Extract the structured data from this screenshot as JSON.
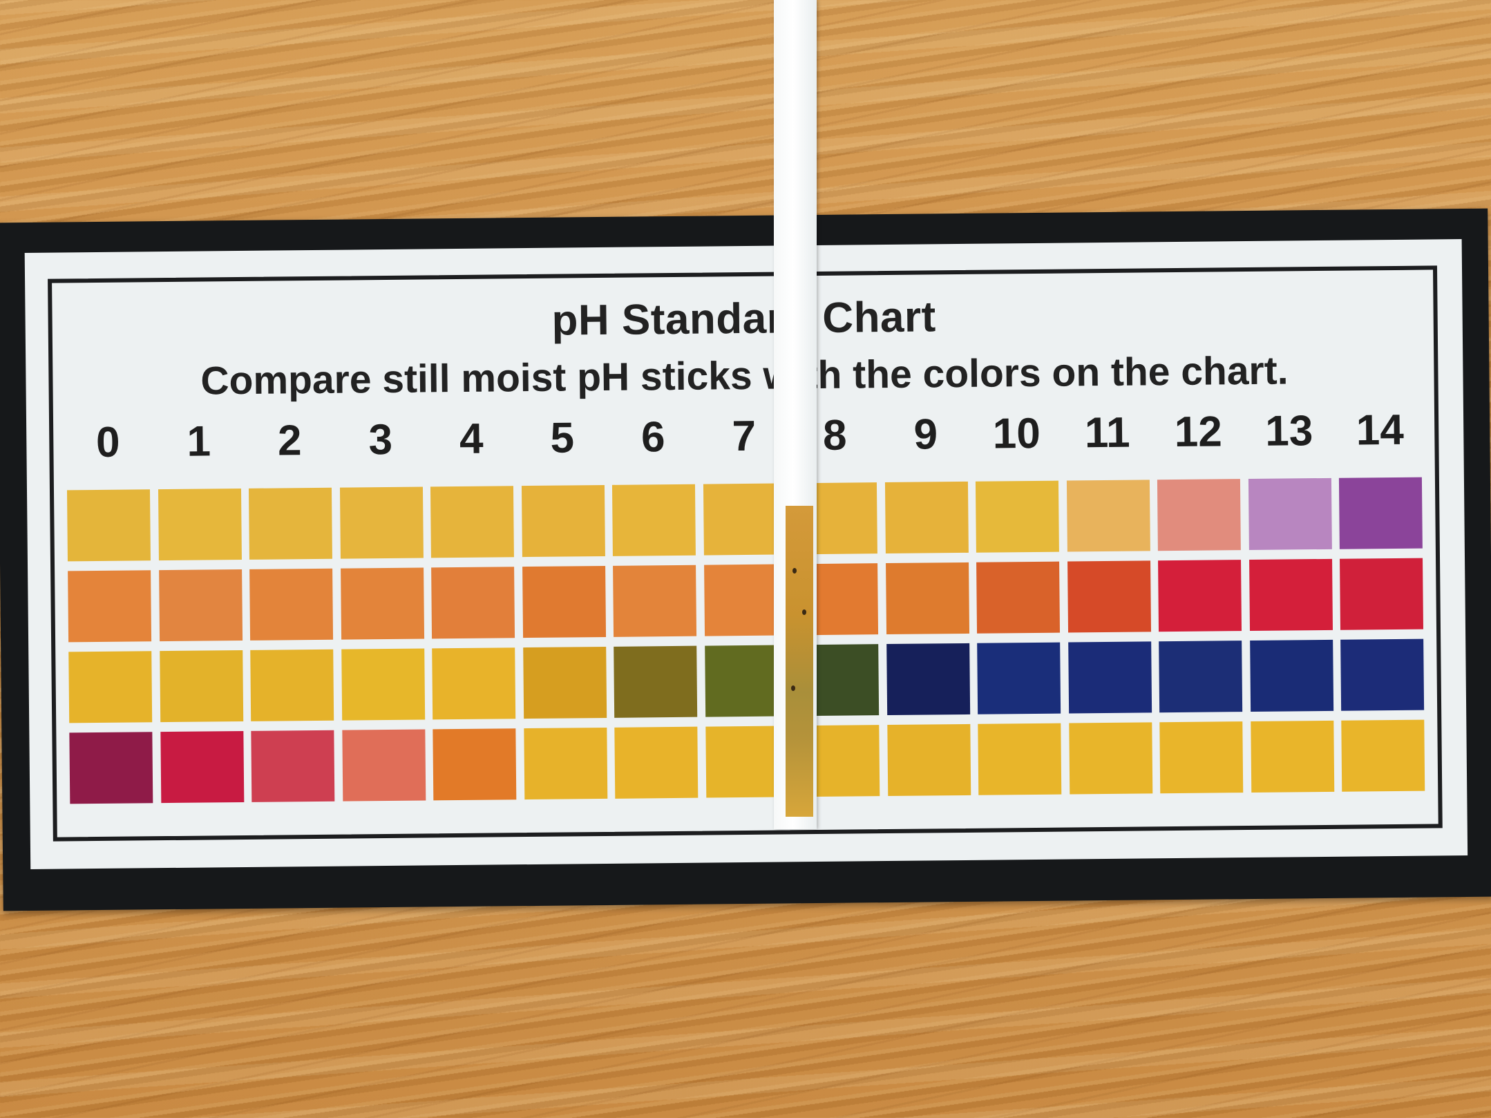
{
  "card": {
    "title": "pH Standard Chart",
    "subtitle": "Compare still moist pH sticks with the colors on the chart.",
    "ph_values": [
      "0",
      "1",
      "2",
      "3",
      "4",
      "5",
      "6",
      "7",
      "8",
      "9",
      "10",
      "11",
      "12",
      "13",
      "14"
    ],
    "rows": [
      [
        "#e4b53a",
        "#e6b73b",
        "#e5b53c",
        "#e6b53d",
        "#e6b43b",
        "#e6b23a",
        "#e7b53a",
        "#e6b33b",
        "#e6b23a",
        "#e6b23a",
        "#e6b93a",
        "#e8b35c",
        "#e18c7d",
        "#b886c0",
        "#8b449a"
      ],
      [
        "#e4843a",
        "#e28540",
        "#e3843a",
        "#e3843a",
        "#e27f3a",
        "#e07a30",
        "#e3843a",
        "#e4843a",
        "#e27a30",
        "#de7b2e",
        "#d9622a",
        "#d64a28",
        "#d41f3a",
        "#d41f3a",
        "#d0203a"
      ],
      [
        "#e6b32a",
        "#e3b22a",
        "#e5b22a",
        "#e7b72a",
        "#e8b32a",
        "#d69e20",
        "#7f6d1e",
        "#616b20",
        "#3c4e25",
        "#16205a",
        "#1a2e7a",
        "#1b2c78",
        "#1c2e76",
        "#1a2c76",
        "#1c2c78"
      ],
      [
        "#8f1b48",
        "#c81b42",
        "#ce3f51",
        "#e06e58",
        "#e27a28",
        "#e7b22a",
        "#e8b32a",
        "#e6b42a",
        "#e6b32a",
        "#e6b22a",
        "#e8b52a",
        "#e8b52a",
        "#e9b52a",
        "#e9b52a",
        "#e9b52a"
      ]
    ]
  }
}
